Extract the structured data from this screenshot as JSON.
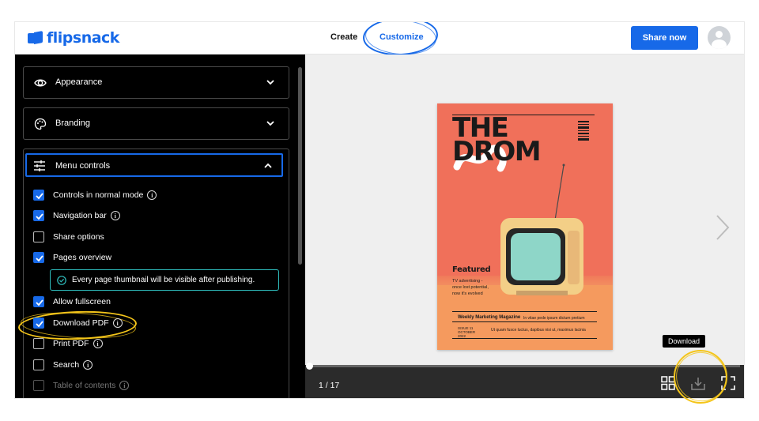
{
  "topbar": {
    "logo_text": "flipsnack",
    "nav_create": "Create",
    "nav_customize": "Customize",
    "share_label": "Share now"
  },
  "panel": {
    "sections": [
      {
        "label": "Appearance",
        "icon": "eye-icon",
        "expanded": false
      },
      {
        "label": "Branding",
        "icon": "palette-icon",
        "expanded": false
      },
      {
        "label": "Menu controls",
        "icon": "sliders-icon",
        "expanded": true
      }
    ],
    "options": [
      {
        "label": "Controls in normal mode",
        "checked": true,
        "info": true
      },
      {
        "label": "Navigation bar",
        "checked": true,
        "info": true
      },
      {
        "label": "Share options",
        "checked": false,
        "info": false
      },
      {
        "label": "Pages overview",
        "checked": true,
        "info": false
      },
      {
        "label": "Allow fullscreen",
        "checked": true,
        "info": false
      },
      {
        "label": "Download PDF",
        "checked": true,
        "info": true
      },
      {
        "label": "Print PDF",
        "checked": false,
        "info": true
      },
      {
        "label": "Search",
        "checked": false,
        "info": true
      },
      {
        "label": "Table of contents",
        "checked": false,
        "info": true,
        "disabled": true
      }
    ],
    "notice": "Every page thumbnail will be visible after publishing."
  },
  "viewer": {
    "page_indicator": "1 / 17",
    "tooltip": "Download",
    "progress_fraction": 0.0
  },
  "cover": {
    "title_line1": "THE",
    "title_line2": "DROM",
    "featured": "Featured",
    "featured_sub": "TV advertising - once lost potential, now it's evolved",
    "magazine": "Weekly Marketing Magazine",
    "magazine_right": "In vitae pede ipsum dictum pretium",
    "issue": "ISSUE 11 OCTOBER 2022",
    "issue_right": "Ut quam fusce luctus, dapibus nisi ut, maximus lacinia"
  },
  "colors": {
    "accent": "#1769e8",
    "highlight": "#f4c51a",
    "notice_border": "#2fbfbf",
    "cover_bg": "#f0705a"
  }
}
